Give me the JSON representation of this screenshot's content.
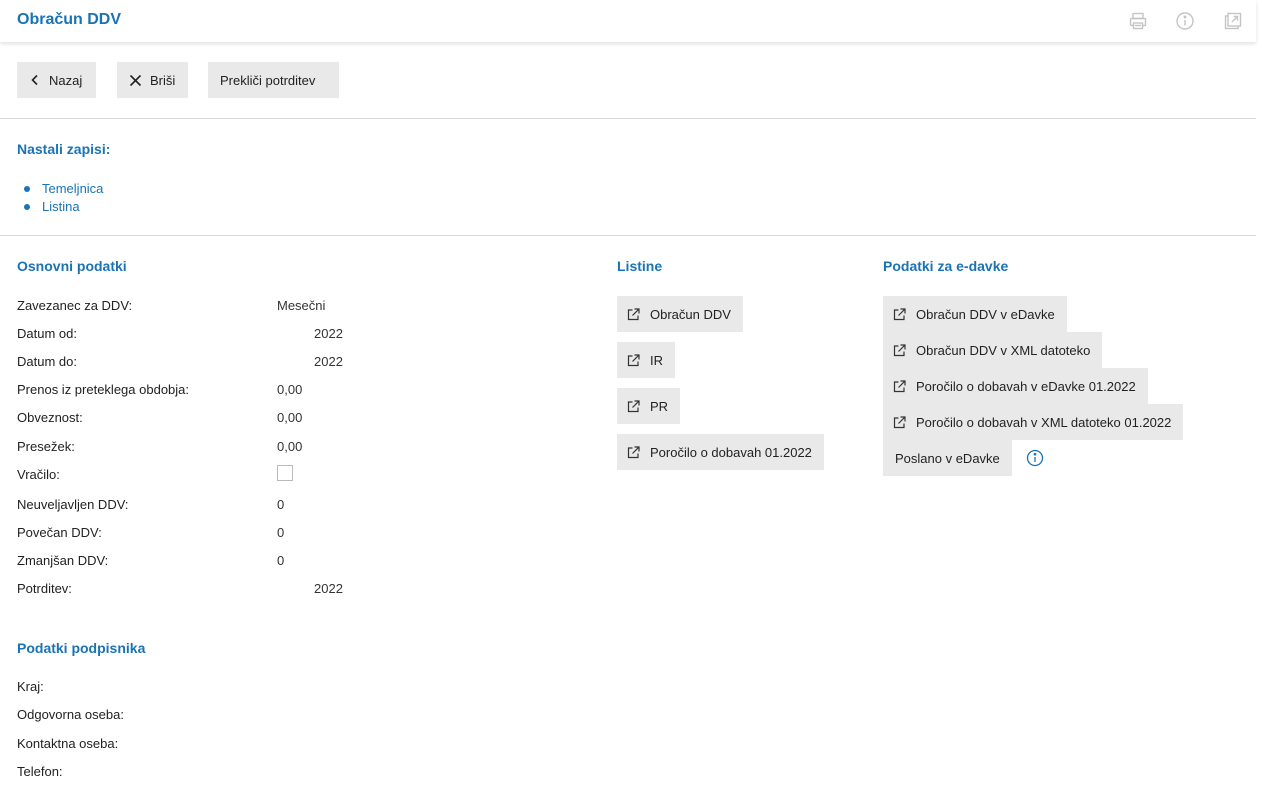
{
  "header": {
    "title": "Obračun DDV"
  },
  "toolbar": {
    "back": "Nazaj",
    "delete": "Briši",
    "cancel_confirm": "Prekliči potrditev"
  },
  "records": {
    "title": "Nastali zapisi:",
    "items": [
      "Temeljnica",
      "Listina"
    ]
  },
  "basic": {
    "title": "Osnovni podatki",
    "fields": [
      {
        "label": "Zavezanec za DDV:",
        "value": "Mesečni"
      },
      {
        "label": "Datum od:",
        "value": "2022"
      },
      {
        "label": "Datum do:",
        "value": "2022"
      },
      {
        "label": "Prenos iz preteklega obdobja:",
        "value": "0,00"
      },
      {
        "label": "Obveznost:",
        "value": "0,00"
      },
      {
        "label": "Presežek:",
        "value": "0,00"
      },
      {
        "label": "Vračilo:",
        "value": ""
      },
      {
        "label": "Neuveljavljen DDV:",
        "value": "0"
      },
      {
        "label": "Povečan DDV:",
        "value": "0"
      },
      {
        "label": "Zmanjšan DDV:",
        "value": "0"
      },
      {
        "label": "Potrditev:",
        "value": "2022"
      }
    ]
  },
  "signer": {
    "title": "Podatki podpisnika",
    "fields": [
      "Kraj:",
      "Odgovorna oseba:",
      "Kontaktna oseba:",
      "Telefon:"
    ]
  },
  "documents": {
    "title": "Listine",
    "items": [
      "Obračun DDV",
      "IR",
      "PR",
      "Poročilo o dobavah 01.2022"
    ]
  },
  "edavki": {
    "title": "Podatki za e-davke",
    "items": [
      "Obračun DDV v eDavke",
      "Obračun DDV v XML datoteko",
      "Poročilo o dobavah v eDavke 01.2022",
      "Poročilo o dobavah v XML datoteko 01.2022"
    ],
    "sent": "Poslano v eDavke"
  },
  "colors": {
    "accent": "#1a73b5",
    "button_bg": "#e9e9e9"
  }
}
